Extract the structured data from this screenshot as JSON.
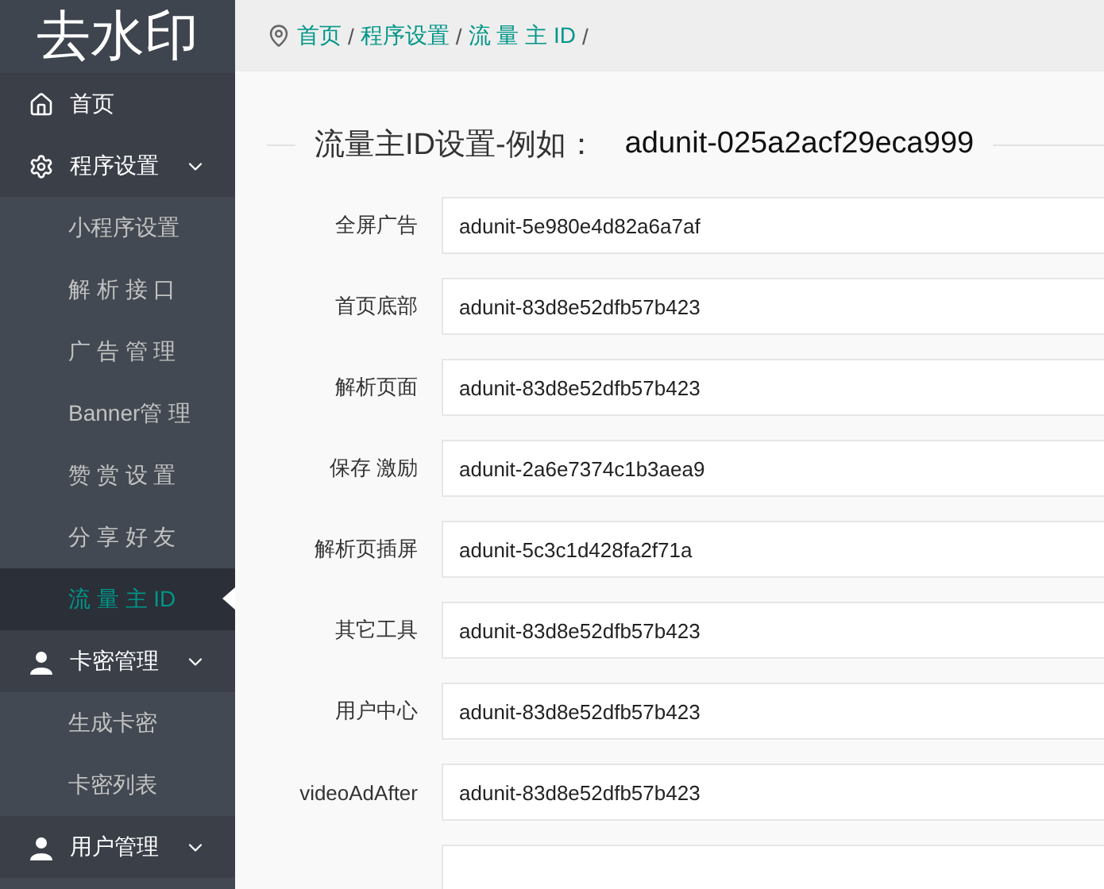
{
  "logo": "去水印",
  "sidebar": {
    "items": [
      {
        "label": "首页",
        "kind": "home",
        "expanded": false
      },
      {
        "label": "程序设置",
        "kind": "gear",
        "expanded": true,
        "children": [
          {
            "label": "小程序设置",
            "selected": false
          },
          {
            "label": "解 析 接 口",
            "selected": false
          },
          {
            "label": "广 告 管 理",
            "selected": false
          },
          {
            "label": "Banner管 理",
            "selected": false
          },
          {
            "label": "赞 赏 设 置",
            "selected": false
          },
          {
            "label": "分 享 好 友",
            "selected": false
          },
          {
            "label": "流 量 主 ID",
            "selected": true
          }
        ]
      },
      {
        "label": "卡密管理",
        "kind": "user",
        "expanded": true,
        "children": [
          {
            "label": "生成卡密",
            "selected": false
          },
          {
            "label": "卡密列表",
            "selected": false
          }
        ]
      },
      {
        "label": "用户管理",
        "kind": "user",
        "expanded": true
      }
    ]
  },
  "breadcrumb": [
    {
      "label": "首页",
      "separator": "/"
    },
    {
      "label": "程序设置",
      "separator": "/"
    },
    {
      "label": "流 量 主 ID",
      "separator": "/"
    }
  ],
  "legend": {
    "title": "流量主ID设置-例如：",
    "example": "adunit-025a2acf29eca999"
  },
  "fields": [
    {
      "label": "全屏广告",
      "value": "adunit-5e980e4d82a6a7af"
    },
    {
      "label": "首页底部",
      "value": "adunit-83d8e52dfb57b423"
    },
    {
      "label": "解析页面",
      "value": "adunit-83d8e52dfb57b423"
    },
    {
      "label": "保存 激励",
      "value": "adunit-2a6e7374c1b3aea9"
    },
    {
      "label": "解析页插屏",
      "value": "adunit-5c3c1d428fa2f71a"
    },
    {
      "label": "其它工具",
      "value": "adunit-83d8e52dfb57b423"
    },
    {
      "label": "用户中心",
      "value": "adunit-83d8e52dfb57b423"
    },
    {
      "label": "videoAdAfter",
      "value": "adunit-83d8e52dfb57b423"
    }
  ],
  "empty_field_below": true
}
